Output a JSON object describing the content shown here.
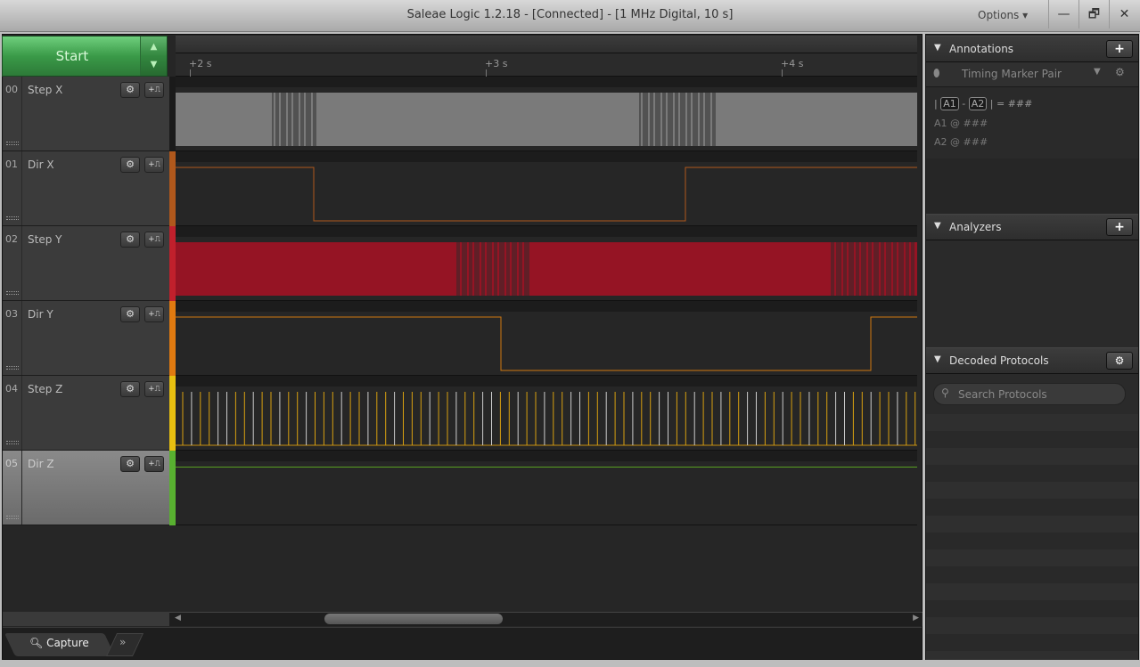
{
  "window": {
    "title": "Saleae Logic 1.2.18 - [Connected] - [1 MHz Digital, 10 s]",
    "options_label": "Options ▾",
    "minimize": "—",
    "restore": "🗗",
    "close": "✕"
  },
  "capture": {
    "start_label": "Start",
    "up": "▲",
    "down": "▼"
  },
  "timeline": {
    "ticks": [
      "+2 s",
      "+3 s",
      "+4 s"
    ]
  },
  "channels": [
    {
      "num": "00",
      "name": "Step X",
      "color": "#1a1a1a",
      "selected": false
    },
    {
      "num": "01",
      "name": "Dir X",
      "color": "#b0581c",
      "selected": false
    },
    {
      "num": "02",
      "name": "Step Y",
      "color": "#c0202c",
      "selected": false
    },
    {
      "num": "03",
      "name": "Dir Y",
      "color": "#e07a10",
      "selected": false
    },
    {
      "num": "04",
      "name": "Step Z",
      "color": "#e8c010",
      "selected": false
    },
    {
      "num": "05",
      "name": "Dir Z",
      "color": "#58b030",
      "selected": true
    }
  ],
  "channel_buttons": {
    "settings": "⚙",
    "trigger": "+⎍"
  },
  "bottom": {
    "tab_label": "Capture",
    "more": "»"
  },
  "annotations": {
    "title": "Annotations",
    "add": "+",
    "marker_type": "Timing Marker Pair",
    "formula": {
      "a1": "A1",
      "a2": "A2",
      "eq": "= ###"
    },
    "lines": [
      "A1  @  ###",
      "A2  @  ###"
    ]
  },
  "analyzers": {
    "title": "Analyzers",
    "add": "+"
  },
  "decoded": {
    "title": "Decoded Protocols",
    "settings": "⚙",
    "search_placeholder": "Search Protocols"
  }
}
